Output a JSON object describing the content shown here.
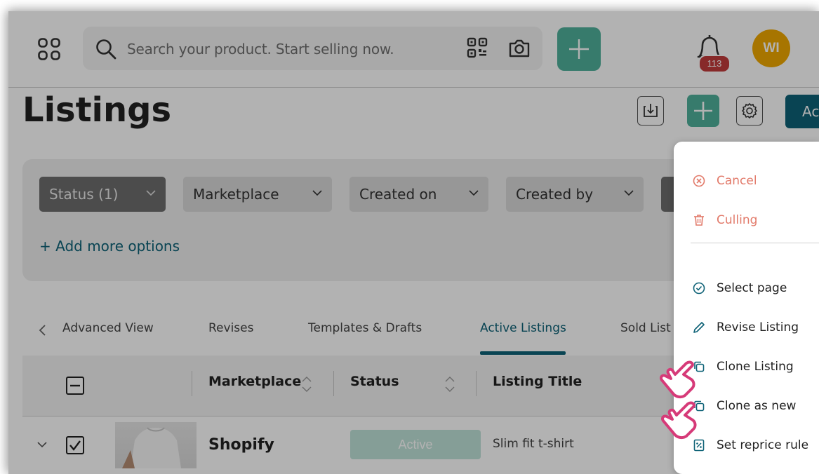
{
  "header": {
    "search_placeholder": "Search your product. Start selling now.",
    "notification_count": "113",
    "avatar_initials": "WI"
  },
  "page": {
    "title": "Listings",
    "action_label": "Ac"
  },
  "filters": {
    "chips": [
      {
        "label": "Status (1)",
        "active": true
      },
      {
        "label": "Marketplace",
        "active": false
      },
      {
        "label": "Created on",
        "active": false
      },
      {
        "label": "Created by",
        "active": false
      }
    ],
    "add_more": "+ Add more options"
  },
  "tabs": [
    {
      "label": "Advanced View",
      "active": false
    },
    {
      "label": "Revises",
      "active": false
    },
    {
      "label": "Templates & Drafts",
      "active": false
    },
    {
      "label": "Active Listings",
      "active": true
    },
    {
      "label": "Sold List",
      "active": false
    }
  ],
  "table": {
    "columns": [
      "Marketplace",
      "Status",
      "Listing Title"
    ],
    "rows": [
      {
        "marketplace": "Shopify",
        "status": "Active",
        "title": "Slim fit t-shirt",
        "checked": true
      }
    ]
  },
  "menu": {
    "items": [
      {
        "label": "Cancel",
        "icon": "cancel-circle-icon",
        "tone": "danger"
      },
      {
        "label": "Culling",
        "icon": "trash-icon",
        "tone": "danger"
      },
      {
        "label": "Select page",
        "icon": "check-circle-icon",
        "tone": "normal"
      },
      {
        "label": "Revise Listing",
        "icon": "pencil-icon",
        "tone": "normal"
      },
      {
        "label": "Clone Listing",
        "icon": "copy-icon",
        "tone": "normal"
      },
      {
        "label": "Clone as new",
        "icon": "copy-icon",
        "tone": "normal"
      },
      {
        "label": "Set reprice rule",
        "icon": "reprice-icon",
        "tone": "normal"
      }
    ]
  },
  "colors": {
    "brand_green": "#4fb09b",
    "brand_teal": "#0e6277",
    "danger": "#e27a6a",
    "badge_red": "#c23b3b",
    "avatar": "#f0a800",
    "cursor_pink": "#d63a78"
  }
}
